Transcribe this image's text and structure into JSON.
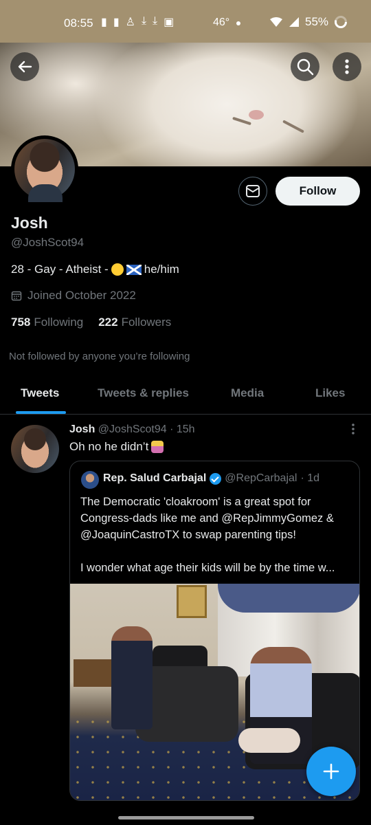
{
  "status_bar": {
    "time": "08:55",
    "temperature": "46°",
    "battery": "55%"
  },
  "profile": {
    "name": "Josh",
    "handle": "@JoshScot94",
    "bio_prefix": "28 - Gay - Atheist -",
    "bio_suffix": "he/him",
    "joined": "Joined October 2022",
    "following_count": "758",
    "following_label": "Following",
    "followers_count": "222",
    "followers_label": "Followers",
    "not_followed_note": "Not followed by anyone you’re following",
    "follow_button": "Follow"
  },
  "tabs": [
    {
      "label": "Tweets",
      "active": true
    },
    {
      "label": "Tweets & replies",
      "active": false
    },
    {
      "label": "Media",
      "active": false
    },
    {
      "label": "Likes",
      "active": false
    }
  ],
  "tweet": {
    "author_name": "Josh",
    "author_handle": "@JoshScot94",
    "time": "· 15h",
    "text": "Oh no he didn’t",
    "quote": {
      "author_name": "Rep. Salud Carbajal",
      "author_handle": "@RepCarbajal",
      "time": "· 1d",
      "line1": "The Democratic 'cloakroom' is a great spot for",
      "line2": "Congress-dads like me and @RepJimmyGomez &",
      "line3": "@JoaquinCastroTX to swap parenting tips!",
      "line4": "I wonder what age their kids will be by the time w..."
    }
  },
  "colors": {
    "accent": "#1d9bf0",
    "background": "#000000",
    "muted_text": "#71767b",
    "status_bar": "#a39170"
  },
  "icons": [
    "back-arrow-icon",
    "search-icon",
    "more-vertical-icon",
    "mail-icon",
    "calendar-icon",
    "verified-badge-icon",
    "compose-plus-icon"
  ]
}
